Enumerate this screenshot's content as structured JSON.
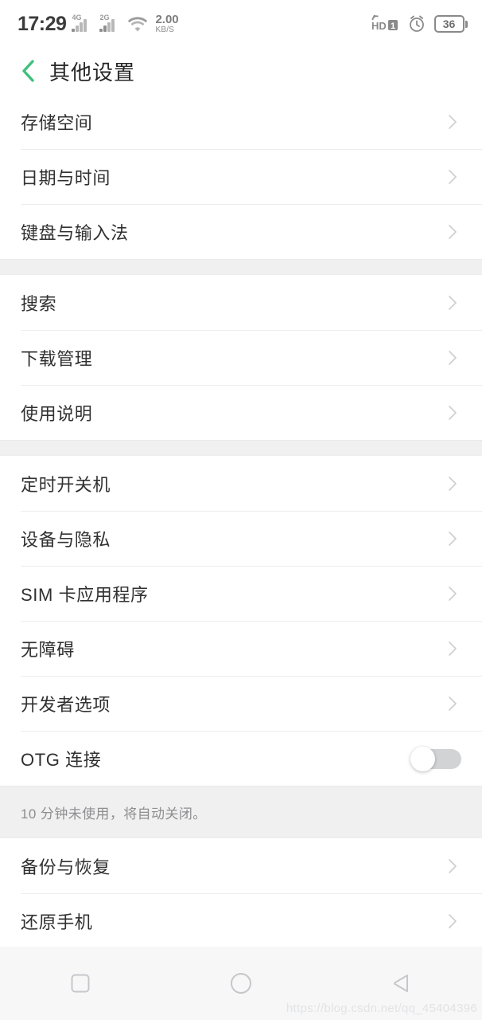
{
  "status_bar": {
    "time": "17:29",
    "signal_1_label": "4G",
    "signal_2_label": "2G",
    "wifi_icon": "wifi-icon",
    "network_speed_value": "2.00",
    "network_speed_unit": "KB/S",
    "volte_label": "HD",
    "volte_sim": "1",
    "alarm_icon": "alarm-clock-icon",
    "battery_percent": "36"
  },
  "header": {
    "back_icon": "back-chevron-icon",
    "title": "其他设置",
    "accent_color": "#3ec17d"
  },
  "groups": [
    {
      "rows": [
        {
          "label": "存储空间",
          "accessory": "chevron"
        },
        {
          "label": "日期与时间",
          "accessory": "chevron"
        },
        {
          "label": "键盘与输入法",
          "accessory": "chevron"
        }
      ]
    },
    {
      "rows": [
        {
          "label": "搜索",
          "accessory": "chevron"
        },
        {
          "label": "下载管理",
          "accessory": "chevron"
        },
        {
          "label": "使用说明",
          "accessory": "chevron"
        }
      ]
    },
    {
      "rows": [
        {
          "label": "定时开关机",
          "accessory": "chevron"
        },
        {
          "label": "设备与隐私",
          "accessory": "chevron"
        },
        {
          "label": "SIM 卡应用程序",
          "accessory": "chevron"
        },
        {
          "label": "无障碍",
          "accessory": "chevron"
        },
        {
          "label": "开发者选项",
          "accessory": "chevron"
        },
        {
          "label": "OTG 连接",
          "accessory": "toggle",
          "toggle_state": "off"
        }
      ],
      "note": "10 分钟未使用，将自动关闭。"
    },
    {
      "rows": [
        {
          "label": "备份与恢复",
          "accessory": "chevron"
        },
        {
          "label": "还原手机",
          "accessory": "chevron"
        }
      ]
    }
  ],
  "nav_bar": {
    "recents_icon": "square-recents-icon",
    "home_icon": "circle-home-icon",
    "back_icon": "triangle-back-icon"
  },
  "watermark": "https://blog.csdn.net/qq_45404396"
}
